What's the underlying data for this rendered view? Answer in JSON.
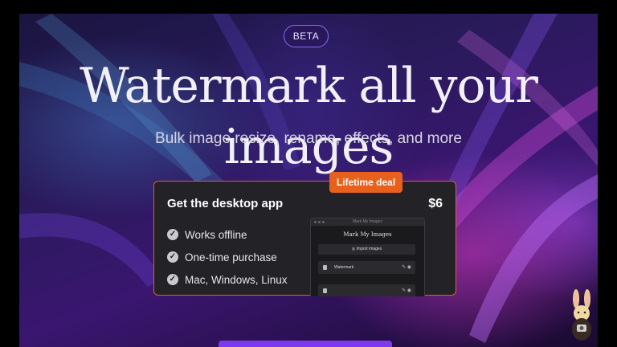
{
  "badge": "BETA",
  "hero": {
    "title": "Watermark all your images",
    "subtitle": "Bulk image resize, rename, effects, and more"
  },
  "offer": {
    "deal_label": "Lifetime deal",
    "title": "Get the desktop app",
    "price": "$6",
    "features": [
      {
        "label": "Works offline",
        "icon": "check-circle-icon"
      },
      {
        "label": "One-time purchase",
        "icon": "check-circle-icon"
      },
      {
        "label": "Mac, Windows, Linux",
        "icon": "check-circle-icon"
      }
    ]
  },
  "app_preview": {
    "window_title": "Mark My Images",
    "heading": "Mark My Images",
    "import_label": "Import images",
    "rows": [
      {
        "label": "Watermark"
      },
      {
        "label": ""
      }
    ]
  },
  "colors": {
    "accent": "#e8611c",
    "cta": "#7c3aed",
    "badge_border": "#8a6cf0"
  }
}
